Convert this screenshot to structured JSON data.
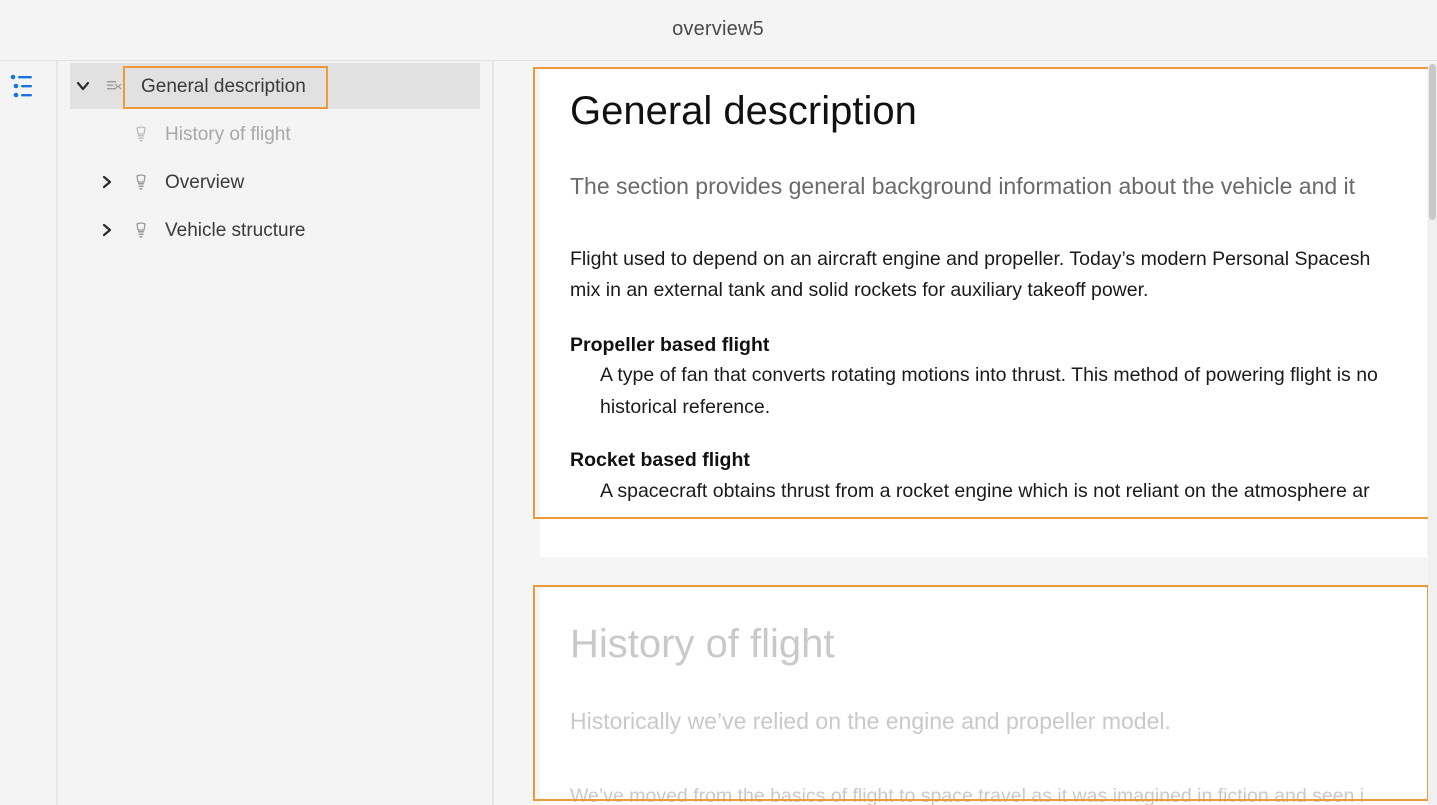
{
  "window": {
    "title": "overview5"
  },
  "toolbar": {
    "toc_icon": "list-icon"
  },
  "tree": {
    "items": [
      {
        "label": "General description",
        "chevron": "chevron-down-icon",
        "icon": "topic-icon",
        "selected": true
      },
      {
        "label": "History of flight",
        "icon": "bulb-icon",
        "dimmed": true
      },
      {
        "label": "Overview",
        "chevron": "chevron-right-icon",
        "icon": "bulb-icon"
      },
      {
        "label": "Vehicle structure",
        "chevron": "chevron-right-icon",
        "icon": "bulb-icon"
      }
    ]
  },
  "content": {
    "section1": {
      "title": "General description",
      "lead": "The section provides general background information about the vehicle and it",
      "para_line1": "Flight used to depend on an aircraft engine and propeller. Today’s modern Personal Spacesh",
      "para_line2": "mix in an external tank and solid rockets for auxiliary takeoff power.",
      "term1": "Propeller based flight",
      "def1_line1": "A type of fan that converts rotating motions into thrust. This method of powering flight is no",
      "def1_line2": "historical reference.",
      "term2": "Rocket based flight",
      "def2_line1": "A spacecraft obtains thrust from a rocket engine which is not reliant on the atmosphere ar"
    },
    "section2": {
      "title": "History of flight",
      "lead": "Historically we’ve relied on the engine and propeller model.",
      "para_line1": "We’ve moved from the basics of flight to space travel as it was imagined in fiction and seen i"
    }
  },
  "colors": {
    "highlight": "#ec9a3a",
    "selected_bg": "#e1e1e1",
    "accent": "#1473e6"
  }
}
